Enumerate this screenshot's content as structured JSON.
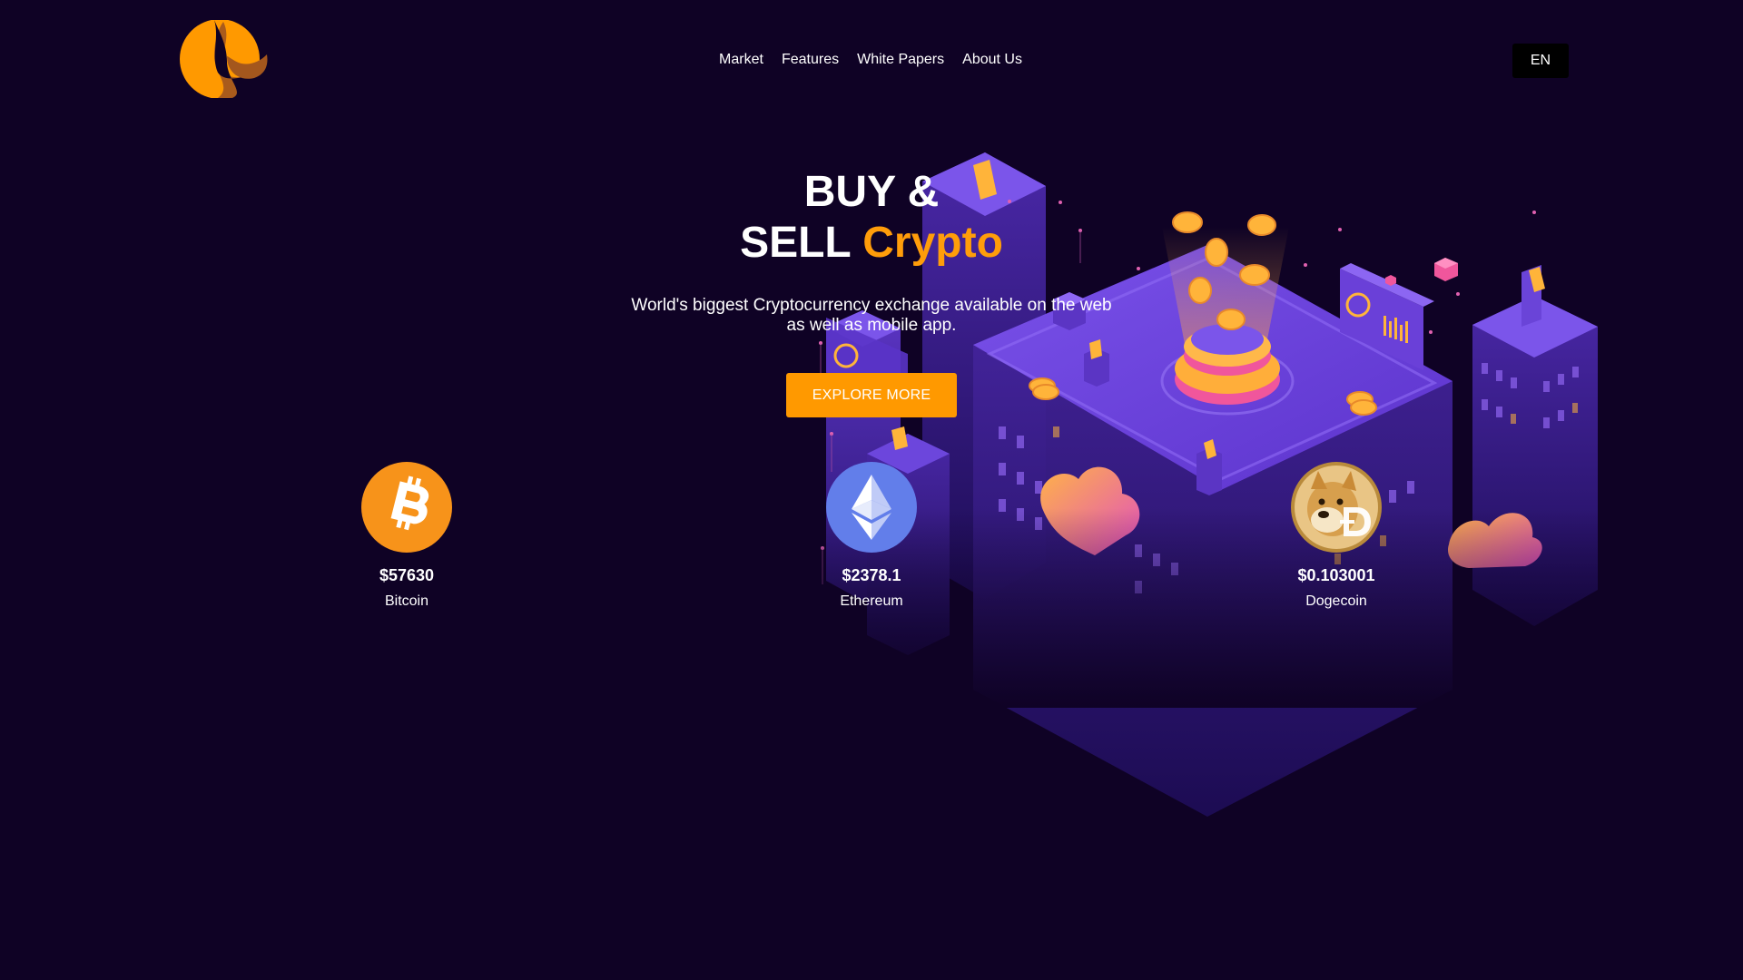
{
  "colors": {
    "background": "#0f0225",
    "accent": "#ff9900",
    "city_purple": "#6a3fd6"
  },
  "brand": {
    "logo_icon": "crescent-logo-icon"
  },
  "nav": {
    "items": [
      {
        "label": "Market"
      },
      {
        "label": "Features"
      },
      {
        "label": "White Papers"
      },
      {
        "label": "About Us"
      }
    ]
  },
  "language": {
    "label": "EN"
  },
  "hero": {
    "title_line1": "BUY &",
    "title_line2_prefix": "SELL",
    "title_line2_accent": "Crypto",
    "subtitle": "World's biggest Cryptocurrency exchange available on the web as well as mobile app.",
    "cta_label": "EXPLORE MORE"
  },
  "coins": [
    {
      "name": "Bitcoin",
      "price": "$57630",
      "icon": "bitcoin-icon"
    },
    {
      "name": "Ethereum",
      "price": "$2378.1",
      "icon": "ethereum-icon"
    },
    {
      "name": "Dogecoin",
      "price": "$0.103001",
      "icon": "dogecoin-icon"
    }
  ]
}
